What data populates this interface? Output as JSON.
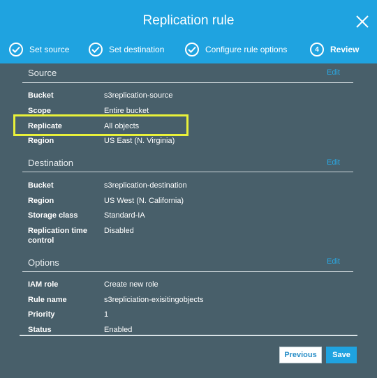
{
  "dialog": {
    "title": "Replication rule"
  },
  "steps": [
    {
      "label": "Set source",
      "status": "done"
    },
    {
      "label": "Set destination",
      "status": "done"
    },
    {
      "label": "Configure rule options",
      "status": "done"
    },
    {
      "label": "Review",
      "number": "4",
      "status": "current"
    }
  ],
  "sections": {
    "source": {
      "title": "Source",
      "edit": "Edit",
      "rows": [
        {
          "label": "Bucket",
          "value": "s3replication-source"
        },
        {
          "label": "Scope",
          "value": "Entire bucket"
        },
        {
          "label": "Replicate",
          "value": "All objects"
        },
        {
          "label": "Region",
          "value": "US East (N. Virginia)"
        }
      ]
    },
    "destination": {
      "title": "Destination",
      "edit": "Edit",
      "rows": [
        {
          "label": "Bucket",
          "value": "s3replication-destination"
        },
        {
          "label": "Region",
          "value": "US West (N. California)"
        },
        {
          "label": "Storage class",
          "value": "Standard-IA"
        },
        {
          "label": "Replication time control",
          "value": "Disabled"
        }
      ]
    },
    "options": {
      "title": "Options",
      "edit": "Edit",
      "rows": [
        {
          "label": "IAM role",
          "value": "Create new role"
        },
        {
          "label": "Rule name",
          "value": "s3repliciation-exisitingobjects"
        },
        {
          "label": "Priority",
          "value": "1"
        },
        {
          "label": "Status",
          "value": "Enabled"
        }
      ]
    }
  },
  "footer": {
    "previous": "Previous",
    "save": "Save"
  },
  "colors": {
    "header": "#1fa3e0",
    "body": "#485f6a",
    "highlight": "#e9f13a",
    "link": "#2aa8e2"
  }
}
